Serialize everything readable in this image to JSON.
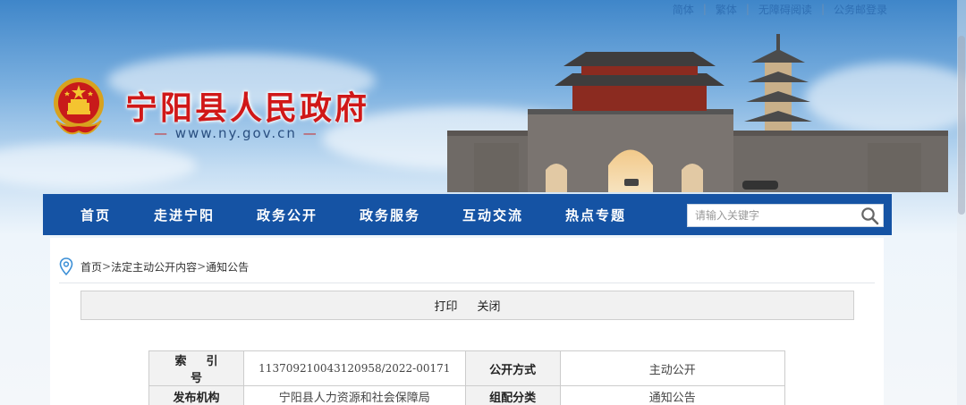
{
  "top_links": [
    "简体",
    "繁体",
    "无障碍阅读",
    "公务邮登录"
  ],
  "site": {
    "title": "宁阳县人民政府",
    "url": "www.ny.gov.cn",
    "url_dash": "—"
  },
  "nav": {
    "items": [
      "首页",
      "走进宁阳",
      "政务公开",
      "政务服务",
      "互动交流",
      "热点专题"
    ],
    "search_placeholder": "请输入关键字"
  },
  "breadcrumb": {
    "items": [
      "首页",
      "法定主动公开内容",
      "通知公告"
    ],
    "separator": ">"
  },
  "actions": {
    "print": "打印",
    "close": "关闭"
  },
  "meta": {
    "index_label": "索引号",
    "index_value": "113709210043120958/2022-00171",
    "disclosure_label": "公开方式",
    "disclosure_value": "主动公开",
    "publisher_label": "发布机构",
    "publisher_value": "宁阳县人力资源和社会保障局",
    "category_label": "组配分类",
    "category_value": "通知公告"
  },
  "colors": {
    "nav_bg": "#1553a4",
    "title_red": "#d01818",
    "link_blue": "#2f6fb3"
  },
  "icons": [
    "national-emblem-icon",
    "search-icon",
    "location-pin-icon"
  ]
}
